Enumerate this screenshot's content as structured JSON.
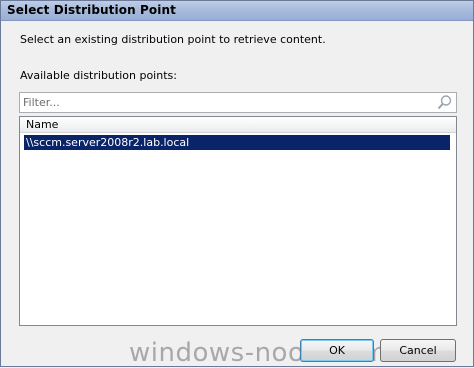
{
  "window": {
    "title": "Select Distribution Point"
  },
  "main": {
    "instruction": "Select an existing distribution point to retrieve content.",
    "available_label": "Available distribution points:",
    "filter": {
      "placeholder": "Filter...",
      "value": ""
    },
    "list": {
      "columns": [
        "Name"
      ],
      "rows": [
        {
          "name": "\\\\sccm.server2008r2.lab.local",
          "selected": true
        }
      ]
    }
  },
  "buttons": {
    "ok_label": "OK",
    "cancel_label": "Cancel"
  },
  "watermark": "windows-noob.com",
  "icons": {
    "filter_search": "search-icon"
  },
  "colors": {
    "selection": "#0a246a",
    "titlebar": "#a8bbdc"
  }
}
